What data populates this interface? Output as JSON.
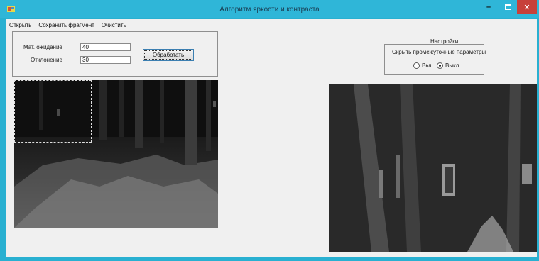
{
  "window": {
    "title": "Алгоритм яркости и контраста",
    "icon": "app-icon",
    "controls": [
      "minimize-icon",
      "maximize-icon",
      "close-icon"
    ]
  },
  "menu": {
    "items": [
      "Открыть",
      "Сохранить фрагмент",
      "Очистить"
    ]
  },
  "params": {
    "mean_label": "Мат. ожидание",
    "mean_value": "40",
    "deviation_label": "Отклонение",
    "deviation_value": "30",
    "process_button": "Обработать"
  },
  "settings": {
    "title": "Настройки",
    "label": "Скрыть промежуточные параметры",
    "options": [
      {
        "label": "Вкл",
        "checked": false
      },
      {
        "label": "Выкл",
        "checked": true
      }
    ]
  },
  "images": {
    "left": "night-forest-photo",
    "right": "enhanced-forest-fragment"
  },
  "colors": {
    "titlebar": "#2fb6d8",
    "close_button": "#c7413a",
    "client_background": "#f0f0f0"
  }
}
